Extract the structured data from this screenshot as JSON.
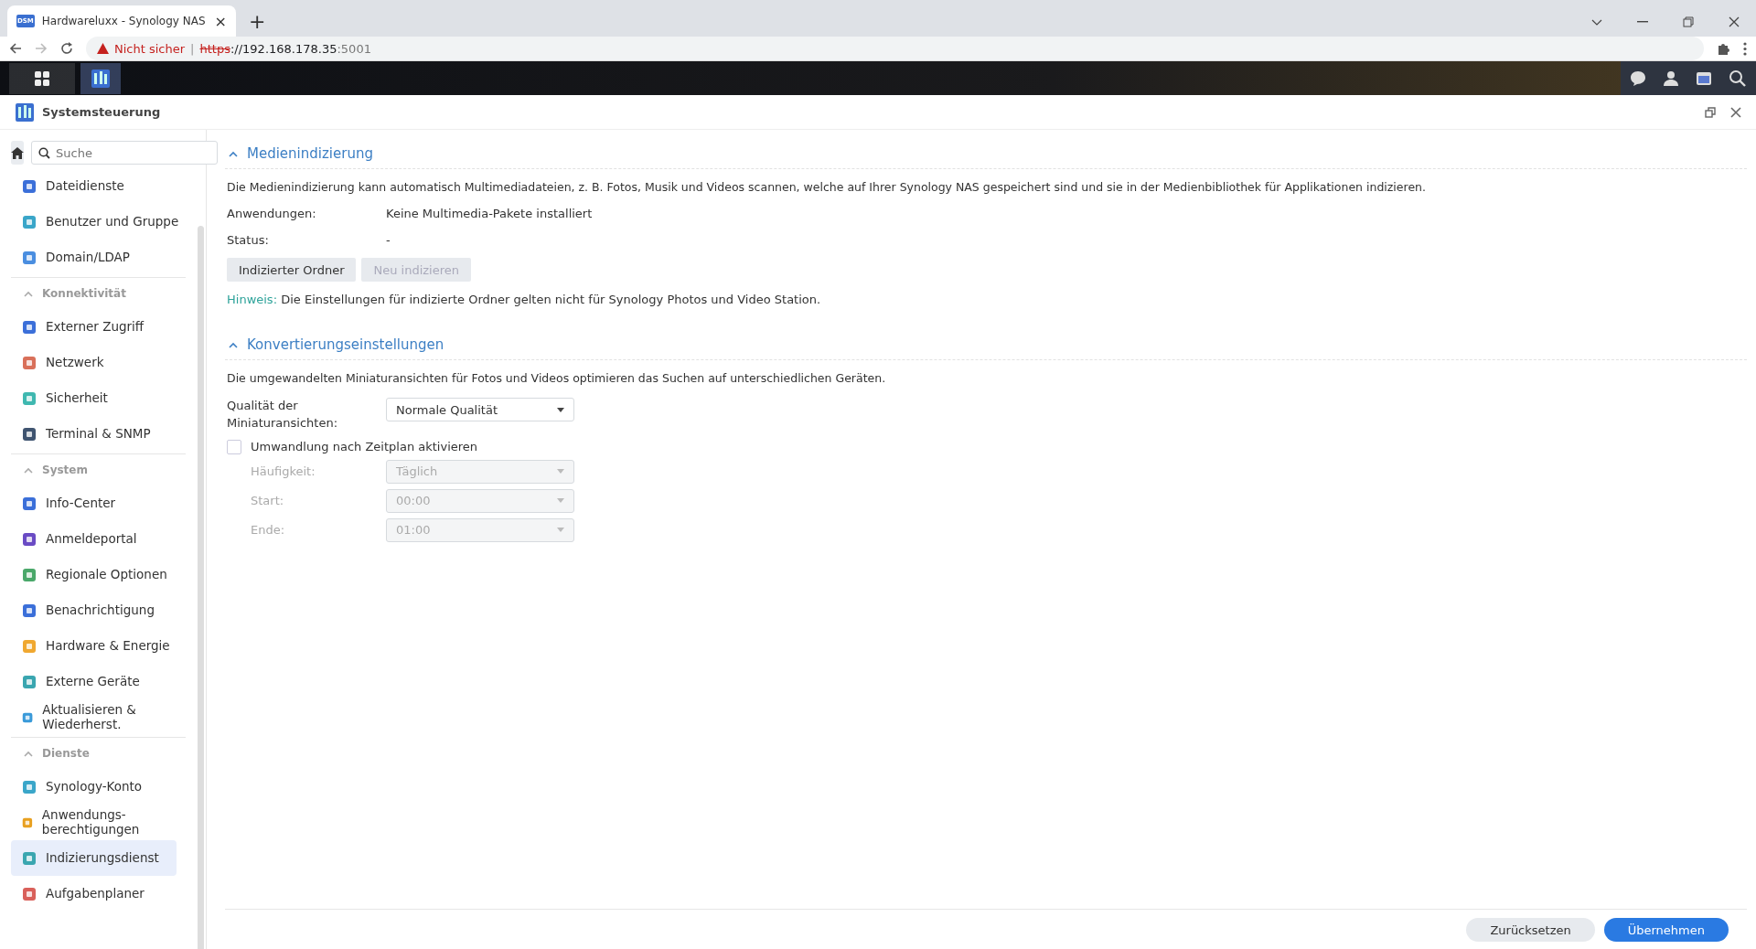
{
  "browser": {
    "tab": {
      "favicon": "DSM",
      "title": "Hardwareluxx - Synology NAS",
      "close": "×"
    },
    "new_tab": "+",
    "security": "Nicht sicher",
    "separator": "|",
    "url_scheme": "https",
    "url_rest": "://192.168.178.35",
    "url_port": ":5001"
  },
  "window": {
    "title": "Systemsteuerung"
  },
  "sidebar": {
    "search": {
      "placeholder": "Suche"
    },
    "items": [
      {
        "label": "Dateidienste",
        "selected": false
      },
      {
        "label": "Benutzer und Gruppe",
        "selected": false
      },
      {
        "label": "Domain/LDAP",
        "selected": false
      }
    ],
    "groups": [
      {
        "title": "Konnektivität",
        "expanded": true,
        "items": [
          {
            "label": "Externer Zugriff",
            "selected": false
          },
          {
            "label": "Netzwerk",
            "selected": false
          },
          {
            "label": "Sicherheit",
            "selected": false
          },
          {
            "label": "Terminal & SNMP",
            "selected": false
          }
        ]
      },
      {
        "title": "System",
        "expanded": true,
        "items": [
          {
            "label": "Info-Center",
            "selected": false
          },
          {
            "label": "Anmeldeportal",
            "selected": false
          },
          {
            "label": "Regionale Optionen",
            "selected": false
          },
          {
            "label": "Benachrichtigung",
            "selected": false
          },
          {
            "label": "Hardware & Energie",
            "selected": false
          },
          {
            "label": "Externe Geräte",
            "selected": false
          },
          {
            "label": "Aktualisieren & Wiederherst.",
            "selected": false
          }
        ]
      },
      {
        "title": "Dienste",
        "expanded": true,
        "items": [
          {
            "label": "Synology-Konto",
            "selected": false
          },
          {
            "label": "Anwendungs-berechtigungen",
            "selected": false
          },
          {
            "label": "Indizierungsdienst",
            "selected": true
          },
          {
            "label": "Aufgabenplaner",
            "selected": false
          }
        ]
      }
    ]
  },
  "sections": [
    {
      "title": "Medienindizierung",
      "expanded": true,
      "description": "Die Medienindizierung kann automatisch Multimediadateien, z. B. Fotos, Musik und Videos scannen, welche auf Ihrer Synology NAS gespeichert sind und sie in der Medienbibliothek für Applikationen indizieren.",
      "fields": [
        {
          "label": "Anwendungen:",
          "value": "Keine Multimedia-Pakete installiert"
        },
        {
          "label": "Status:",
          "value": "-"
        }
      ],
      "buttons": [
        {
          "label": "Indizierter Ordner",
          "disabled": false
        },
        {
          "label": "Neu indizieren",
          "disabled": true
        }
      ],
      "note": {
        "label": "Hinweis:",
        "text": "Die Einstellungen für indizierte Ordner gelten nicht für Synology Photos und Video Station."
      }
    },
    {
      "title": "Konvertierungseinstellungen",
      "expanded": true,
      "description": "Die umgewandelten Miniaturansichten für Fotos und Videos optimieren das Suchen auf unterschiedlichen Geräten.",
      "quality": {
        "label": "Qualität der Miniaturansichten:",
        "value": "Normale Qualität",
        "disabled": false
      },
      "schedule": {
        "label": "Umwandlung nach Zeitplan aktivieren",
        "checked": false
      },
      "schedule_fields": [
        {
          "label": "Häufigkeit:",
          "value": "Täglich",
          "disabled": true
        },
        {
          "label": "Start:",
          "value": "00:00",
          "disabled": true
        },
        {
          "label": "Ende:",
          "value": "01:00",
          "disabled": true
        }
      ]
    }
  ],
  "footer": {
    "buttons": [
      {
        "label": "Zurücksetzen",
        "kind": "secondary"
      },
      {
        "label": "Übernehmen",
        "kind": "primary"
      }
    ]
  }
}
